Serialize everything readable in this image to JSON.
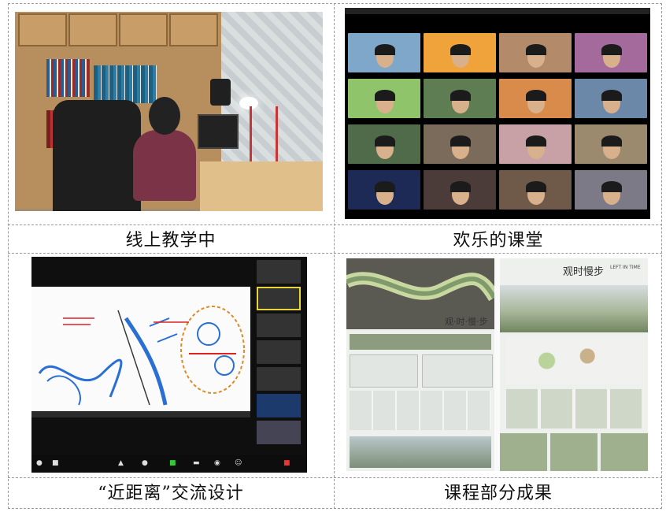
{
  "captions": {
    "top_left": "线上教学中",
    "top_right": "欢乐的课堂",
    "bottom_left": "“近距离”交流设计",
    "bottom_right": "课程部分成果"
  },
  "photos": {
    "top_left": {
      "icon": "teaching-online-photo"
    },
    "top_right": {
      "icon": "video-call-gallery-photo"
    },
    "bottom_left": {
      "icon": "screen-share-drawing-photo"
    },
    "bottom_right": {
      "icon": "design-posters-photo"
    }
  },
  "poster_text": {
    "title_left": "观·时·慢·步",
    "title_right": "观时慢步",
    "subtitle_right": "LEFT IN TIME"
  },
  "colors": {
    "grid_border": "#9a9a9a",
    "caption_text": "#111111",
    "zoom_bg": "#000000",
    "share_highlight": "#e8d53a"
  }
}
